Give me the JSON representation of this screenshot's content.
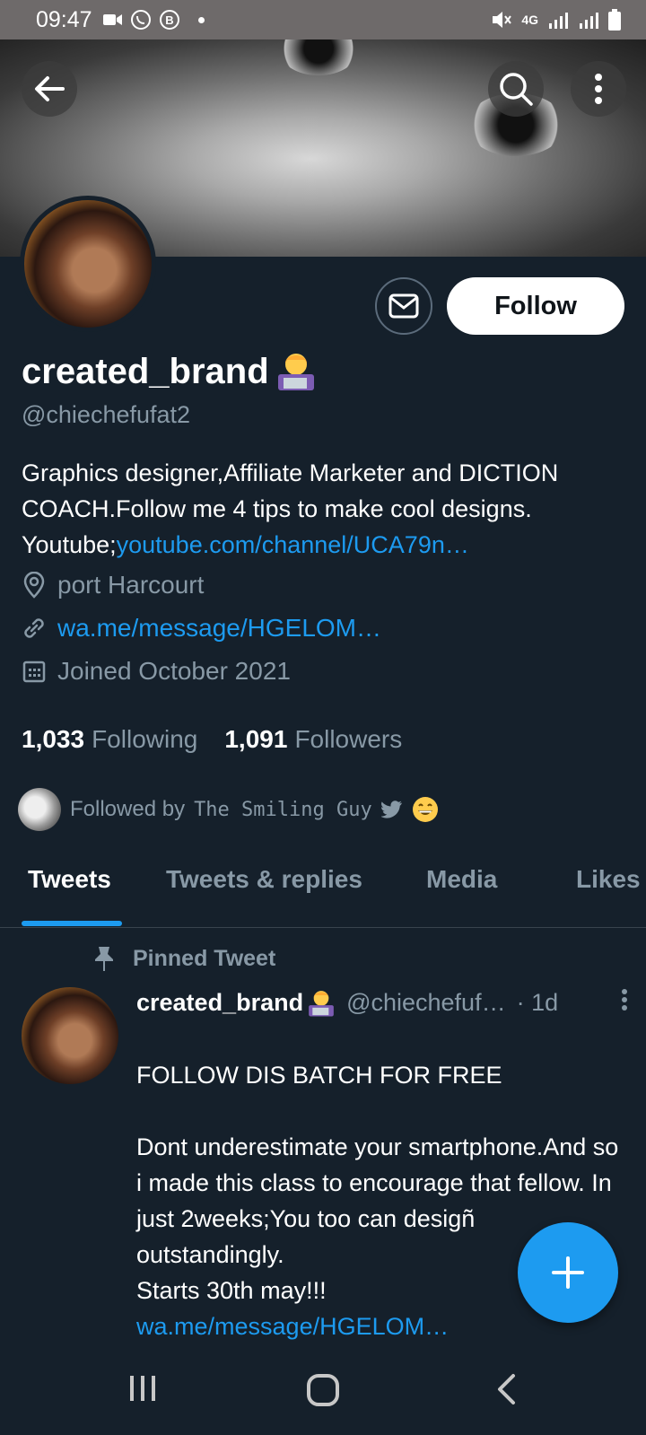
{
  "status_bar": {
    "time": "09:47",
    "network": "4G"
  },
  "profile": {
    "display_name": "created_brand",
    "handle": "@chiechefufat2",
    "bio_text": "Graphics designer,Affiliate Marketer and DICTION COACH.Follow me 4 tips to make cool designs. Youtube;",
    "bio_link": "youtube.com/channel/UCA79n…",
    "location": "port Harcourt",
    "website": "wa.me/message/HGELOM…",
    "joined": "Joined October 2021",
    "following_count": "1,033",
    "following_label": "Following",
    "followers_count": "1,091",
    "followers_label": "Followers",
    "followed_by_prefix": "Followed by",
    "followed_by_name": "The Smiling Guy",
    "follow_button": "Follow"
  },
  "tabs": [
    {
      "label": "Tweets",
      "active": true
    },
    {
      "label": "Tweets & replies",
      "active": false
    },
    {
      "label": "Media",
      "active": false
    },
    {
      "label": "Likes",
      "active": false
    }
  ],
  "pinned_tweet": {
    "pinned_label": "Pinned Tweet",
    "author_name": "created_brand",
    "author_handle": "@chiechefuf…",
    "time": "· 1d",
    "text": "FOLLOW DIS BATCH FOR FREE\n\nDont underestimate your smartphone.And so i made this class to encourage that fellow.  In just 2weeks;You too can desigñ outstandingly.\nStarts 30th may!!!",
    "link": "wa.me/message/HGELOM…"
  },
  "colors": {
    "background": "#15202b",
    "accent": "#1d9bf0",
    "secondary_text": "#8899a6",
    "status_bar": "#6e6a6a"
  },
  "icons": [
    "back-arrow-icon",
    "search-icon",
    "more-vertical-icon",
    "mail-icon",
    "location-pin-icon",
    "link-icon",
    "calendar-icon",
    "twitter-bird-icon",
    "grin-emoji-icon",
    "pin-icon",
    "compose-plus-icon",
    "recents-icon",
    "home-icon",
    "back-icon"
  ]
}
